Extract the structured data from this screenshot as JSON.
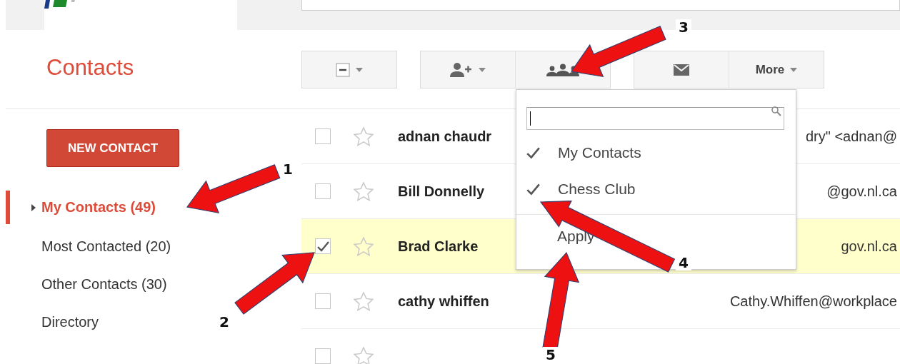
{
  "app": {
    "title": "Contacts"
  },
  "toolbar": {
    "more_label": "More"
  },
  "sidebar": {
    "new_contact": "NEW CONTACT",
    "items": [
      {
        "label": "My Contacts (49)",
        "selected": true,
        "has_children": true
      },
      {
        "label": "Most Contacted (20)",
        "selected": false,
        "has_children": false
      },
      {
        "label": "Other Contacts (30)",
        "selected": false,
        "has_children": false
      },
      {
        "label": "Directory",
        "selected": false,
        "has_children": false
      }
    ]
  },
  "contacts": [
    {
      "name": "adnan chaudr",
      "email": "dry\" <adnan@",
      "checked": false,
      "starred": false
    },
    {
      "name": "Bill Donnelly",
      "email": "@gov.nl.ca",
      "checked": false,
      "starred": false
    },
    {
      "name": "Brad Clarke",
      "email": "gov.nl.ca",
      "checked": true,
      "starred": false
    },
    {
      "name": "cathy whiffen",
      "email": "Cathy.Whiffen@workplace",
      "checked": false,
      "starred": false
    },
    {
      "checked": false,
      "starred": false
    }
  ],
  "group_menu": {
    "items": [
      {
        "label": "My Contacts",
        "checked": true
      },
      {
        "label": "Chess Club",
        "checked": true
      }
    ],
    "apply": "Apply"
  },
  "annotations": [
    {
      "label": "1"
    },
    {
      "label": "2"
    },
    {
      "label": "3"
    },
    {
      "label": "4"
    },
    {
      "label": "5"
    }
  ]
}
